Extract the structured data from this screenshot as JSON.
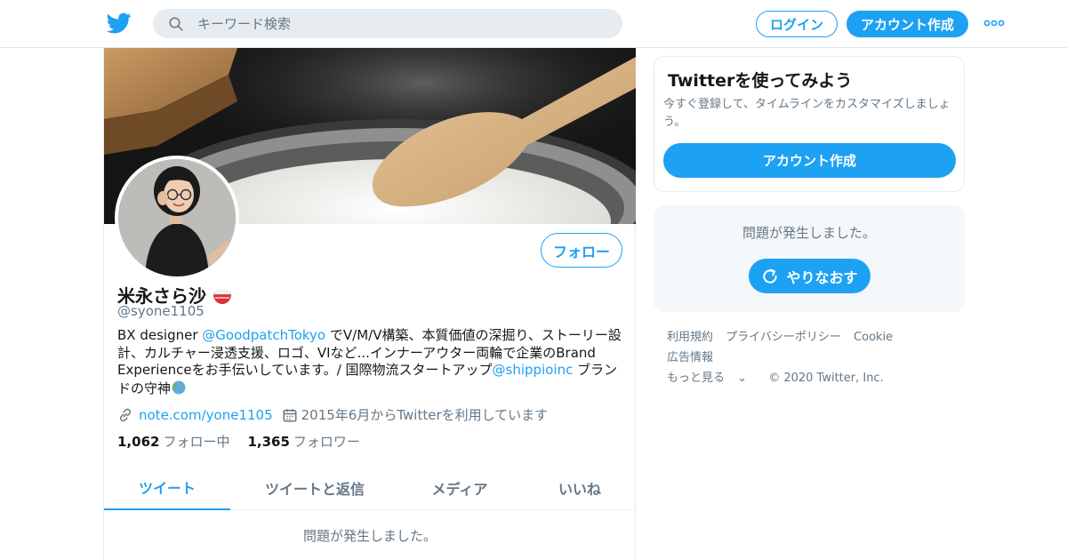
{
  "header": {
    "search_placeholder": "キーワード検索",
    "login_label": "ログイン",
    "signup_label": "アカウント作成"
  },
  "profile": {
    "follow_label": "フォロー",
    "name": "米永さら沙",
    "handle": "@syone1105",
    "bio": {
      "part1": "BX designer ",
      "mention1": "@GoodpatchTokyo",
      "part2": " でV/M/V構築、本質価値の深掘り、ストーリー設計、カルチャー浸透支援、ロゴ、VIなど...インナーアウター両輪で企業のBrand Experienceをお手伝いしています。/ 国際物流スタートアップ",
      "mention2": "@shippioinc",
      "part3": " ブランドの守神"
    },
    "link": "note.com/yone1105",
    "joined": "2015年6月からTwitterを利用しています",
    "following_count": "1,062",
    "following_label": "フォロー中",
    "followers_count": "1,365",
    "followers_label": "フォロワー"
  },
  "tabs": [
    {
      "label": "ツイート",
      "active": true
    },
    {
      "label": "ツイートと返信",
      "active": false
    },
    {
      "label": "メディア",
      "active": false
    },
    {
      "label": "いいね",
      "active": false
    }
  ],
  "main_error": "問題が発生しました。",
  "sidebar": {
    "signup_card": {
      "title": "Twitterを使ってみよう",
      "text": "今すぐ登録して、タイムラインをカスタマイズしましょう。",
      "button": "アカウント作成"
    },
    "error_card": {
      "message": "問題が発生しました。",
      "retry_label": "やりなおす"
    },
    "footer": {
      "terms": "利用規約",
      "privacy": "プライバシーポリシー",
      "cookie": "Cookie",
      "ads": "広告情報",
      "more": "もっと見る",
      "copyright": "© 2020 Twitter, Inc."
    }
  },
  "colors": {
    "accent": "#1da1f2",
    "secondary_text": "#657786",
    "primary_text": "#14171a"
  }
}
